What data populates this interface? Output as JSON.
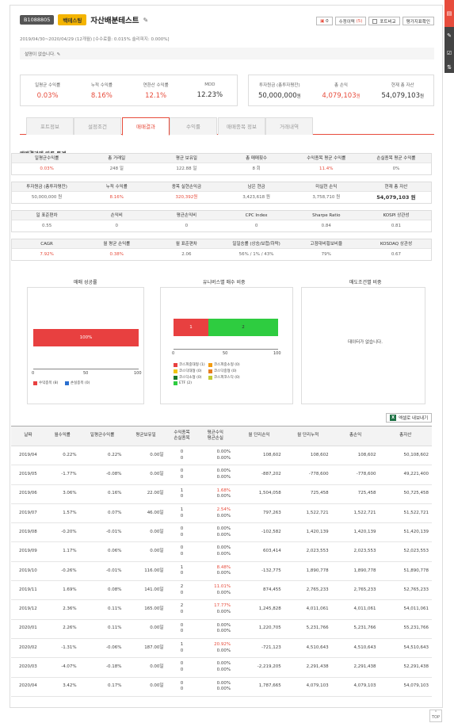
{
  "header": {
    "code": "B1088805",
    "tag": "백테스팅",
    "title": "자산배분테스트",
    "pencil": "✎",
    "btn_count_label": "0",
    "btn_lock_label": "수정이력",
    "btn_lock_count": "(5)",
    "btn_compare": "포트비교",
    "btn_eval": "평가지표확인",
    "subtitle": "2019/04/30~2020/04/29 (12개월) [수수료율: 0.015% 슬리피지: 0.000%]",
    "description": "설명이 없습니다."
  },
  "summary1": [
    {
      "label": "일평균 수익률",
      "value": "0.03%",
      "red": true
    },
    {
      "label": "누적 수익률",
      "value": "8.16%",
      "red": true
    },
    {
      "label": "연환산 수익률",
      "value": "12.1%",
      "red": true
    },
    {
      "label": "MDD",
      "value": "12.23%",
      "red": false
    }
  ],
  "summary2": [
    {
      "label": "투자원금 (총투자평잔)",
      "value": "50,000,000",
      "unit": "원",
      "red": false
    },
    {
      "label": "총 손익",
      "value": "4,079,103",
      "unit": "원",
      "red": true
    },
    {
      "label": "현재 총 자산",
      "value": "54,079,103",
      "unit": "원",
      "red": false
    }
  ],
  "tabs": [
    "포트정보",
    "설정조건",
    "매매결과",
    "수익률",
    "매매종목 정보",
    "거래내역"
  ],
  "section_title": "매매결과에 따른 통계",
  "stats": [
    [
      [
        "일평균수익률",
        "0.03%",
        "red"
      ],
      [
        "총 거래일",
        "248 일",
        ""
      ],
      [
        "평균 보유일",
        "122.88 일",
        ""
      ],
      [
        "총 매매횟수",
        "8 회",
        ""
      ],
      [
        "수익종목 평균 수익률",
        "11.4%",
        "red"
      ],
      [
        "손실종목 평균 수익률",
        "0%",
        ""
      ]
    ],
    [
      [
        "투자원금 (총투자평잔)",
        "50,000,000 원",
        ""
      ],
      [
        "누적 수익률",
        "8.16%",
        "red"
      ],
      [
        "종목 실현손익금",
        "320,392원",
        "red"
      ],
      [
        "남은 현금",
        "3,423,618 원",
        ""
      ],
      [
        "미실현 손익",
        "3,758,710 원",
        ""
      ],
      [
        "현재 총 자산",
        "54,079,103 원",
        "big"
      ]
    ],
    [
      [
        "일 표준편차",
        "0.55",
        ""
      ],
      [
        "손익비",
        "0",
        ""
      ],
      [
        "평균손익비",
        "0",
        ""
      ],
      [
        "CPC Index",
        "0",
        ""
      ],
      [
        "Sharpe Ratio",
        "0.84",
        ""
      ],
      [
        "KOSPI 상관성",
        "0.81",
        ""
      ]
    ],
    [
      [
        "CAGR",
        "7.92%",
        "red"
      ],
      [
        "월 평균 손익률",
        "0.38%",
        "red"
      ],
      [
        "월 표준편차",
        "2.06",
        ""
      ],
      [
        "일일승률 (상승/보합/하락)",
        "56% / 1% / 43%",
        ""
      ],
      [
        "고점대비횡보비율",
        "79%",
        ""
      ],
      [
        "KOSDAQ 상관성",
        "0.67",
        ""
      ]
    ]
  ],
  "charts": {
    "win": {
      "title": "매매 성공률",
      "bar_label": "100%",
      "ticks": [
        "0",
        "50",
        "100"
      ],
      "legend": [
        "수익종목 (8)",
        "손실종목 (0)"
      ]
    },
    "universe": {
      "title": "유니버스별 매수 비중",
      "bar1": "1",
      "bar2": "2",
      "ticks": [
        "0",
        "50",
        "100"
      ],
      "legend": [
        "코스피중대형 (1)",
        "코스피중소형 (0)",
        "코스닥대형 (0)",
        "코스닥중형 (0)",
        "코스닥소형 (0)",
        "코스피코스닥 (0)",
        "ETF (2)"
      ]
    },
    "sell": {
      "title": "매도조건별 비중",
      "empty": "데이터가 없습니다."
    }
  },
  "chart_data": [
    {
      "type": "bar",
      "title": "매매 성공률",
      "categories": [
        "수익종목",
        "손실종목"
      ],
      "values": [
        100,
        0
      ],
      "xlim": [
        0,
        100
      ]
    },
    {
      "type": "bar",
      "title": "유니버스별 매수 비중",
      "categories": [
        "코스피중대형",
        "ETF"
      ],
      "values": [
        1,
        2
      ],
      "xlim": [
        0,
        100
      ]
    }
  ],
  "excel_label": "엑셀로 내보내기",
  "table": {
    "headers": [
      "날짜",
      "월수익률",
      "일평균수익률",
      "평균보유일",
      "수익종목\n손실종목",
      "평균수익\n평균손실",
      "월 단리손익",
      "월 단리누적",
      "총손익",
      "총자산"
    ],
    "rows": [
      [
        "2019/04",
        "0.22%",
        "0.22%",
        "0.00일",
        "0\n0",
        "0.00%\n0.00%",
        "108,602",
        "108,602",
        "108,602",
        "50,108,602"
      ],
      [
        "2019/05",
        "-1.77%",
        "-0.08%",
        "0.00일",
        "0\n0",
        "0.00%\n0.00%",
        "-887,202",
        "-778,600",
        "-778,600",
        "49,221,400"
      ],
      [
        "2019/06",
        "3.06%",
        "0.16%",
        "22.00일",
        "1\n0",
        "1.68%\n0.00%",
        "1,504,058",
        "725,458",
        "725,458",
        "50,725,458"
      ],
      [
        "2019/07",
        "1.57%",
        "0.07%",
        "46.00일",
        "1\n0",
        "2.54%\n0.00%",
        "797,263",
        "1,522,721",
        "1,522,721",
        "51,522,721"
      ],
      [
        "2019/08",
        "-0.20%",
        "-0.01%",
        "0.00일",
        "0\n0",
        "0.00%\n0.00%",
        "-102,582",
        "1,420,139",
        "1,420,139",
        "51,420,139"
      ],
      [
        "2019/09",
        "1.17%",
        "0.06%",
        "0.00일",
        "0\n0",
        "0.00%\n0.00%",
        "603,414",
        "2,023,553",
        "2,023,553",
        "52,023,553"
      ],
      [
        "2019/10",
        "-0.26%",
        "-0.01%",
        "116.00일",
        "1\n0",
        "8.48%\n0.00%",
        "-132,775",
        "1,890,778",
        "1,890,778",
        "51,890,778"
      ],
      [
        "2019/11",
        "1.69%",
        "0.08%",
        "141.00일",
        "2\n0",
        "11.01%\n0.00%",
        "874,455",
        "2,765,233",
        "2,765,233",
        "52,765,233"
      ],
      [
        "2019/12",
        "2.36%",
        "0.11%",
        "165.00일",
        "2\n0",
        "17.77%\n0.00%",
        "1,245,828",
        "4,011,061",
        "4,011,061",
        "54,011,061"
      ],
      [
        "2020/01",
        "2.26%",
        "0.11%",
        "0.00일",
        "0\n0",
        "0.00%\n0.00%",
        "1,220,705",
        "5,231,766",
        "5,231,766",
        "55,231,766"
      ],
      [
        "2020/02",
        "-1.31%",
        "-0.06%",
        "187.00일",
        "1\n0",
        "20.92%\n0.00%",
        "-721,123",
        "4,510,643",
        "4,510,643",
        "54,510,643"
      ],
      [
        "2020/03",
        "-4.07%",
        "-0.18%",
        "0.00일",
        "0\n0",
        "0.00%\n0.00%",
        "-2,219,205",
        "2,291,438",
        "2,291,438",
        "52,291,438"
      ],
      [
        "2020/04",
        "3.42%",
        "0.17%",
        "0.00일",
        "0\n0",
        "0.00%\n0.00%",
        "1,787,665",
        "4,079,103",
        "4,079,103",
        "54,079,103"
      ]
    ]
  },
  "top_label": "TOP",
  "colors": {
    "accent": "#e74c3c",
    "win": "#e84040",
    "loss": "#2a6fcf",
    "etf": "#2ecc40"
  }
}
